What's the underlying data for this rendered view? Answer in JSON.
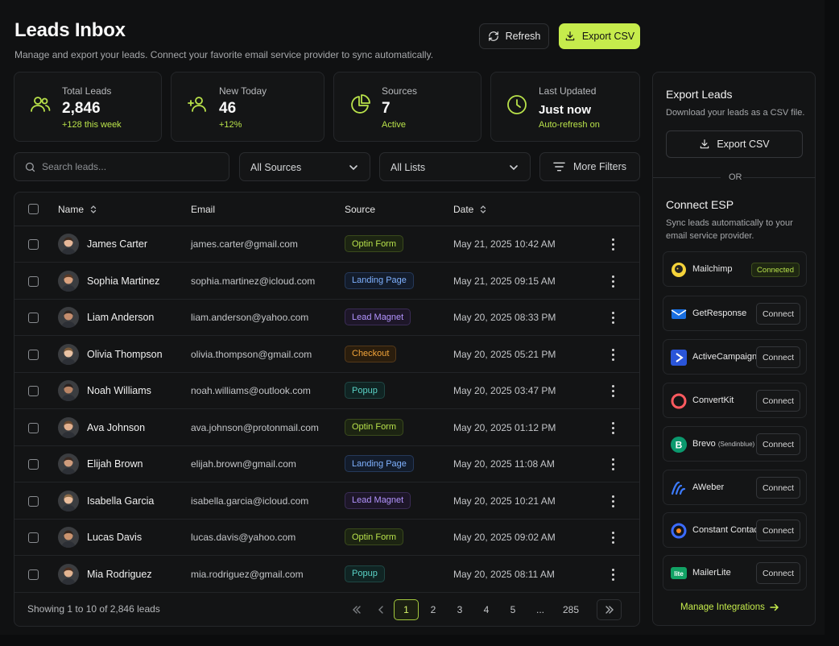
{
  "header": {
    "title": "Leads Inbox",
    "subtitle": "Manage and export your leads. Connect your favorite email service provider to sync automatically.",
    "refresh_label": "Refresh",
    "export_label": "Export CSV"
  },
  "stats": [
    {
      "label": "Total Leads",
      "value": "2,846",
      "sub": "+128 this week",
      "icon": "users-icon"
    },
    {
      "label": "New Today",
      "value": "46",
      "sub": "+12%",
      "icon": "user-plus-icon"
    },
    {
      "label": "Sources",
      "value": "7",
      "sub": "Active",
      "icon": "pie-chart-icon"
    },
    {
      "label": "Last Updated",
      "value": "Just now",
      "sub": "Auto-refresh on",
      "icon": "clock-icon"
    }
  ],
  "filters": {
    "search_placeholder": "Search leads...",
    "sources": "All Sources",
    "lists": "All Lists",
    "more": "More Filters"
  },
  "table": {
    "columns": {
      "name": "Name",
      "email": "Email",
      "source": "Source",
      "date": "Date"
    },
    "rows": [
      {
        "name": "James Carter",
        "email": "james.carter@gmail.com",
        "source": "Optin Form",
        "date": "May 21, 2025 10:42 AM"
      },
      {
        "name": "Sophia Martinez",
        "email": "sophia.martinez@icloud.com",
        "source": "Landing Page",
        "date": "May 21, 2025 09:15 AM"
      },
      {
        "name": "Liam Anderson",
        "email": "liam.anderson@yahoo.com",
        "source": "Lead Magnet",
        "date": "May 20, 2025 08:33 PM"
      },
      {
        "name": "Olivia Thompson",
        "email": "olivia.thompson@gmail.com",
        "source": "Checkout",
        "date": "May 20, 2025 05:21 PM"
      },
      {
        "name": "Noah Williams",
        "email": "noah.williams@outlook.com",
        "source": "Popup",
        "date": "May 20, 2025 03:47 PM"
      },
      {
        "name": "Ava Johnson",
        "email": "ava.johnson@protonmail.com",
        "source": "Optin Form",
        "date": "May 20, 2025 01:12 PM"
      },
      {
        "name": "Elijah Brown",
        "email": "elijah.brown@gmail.com",
        "source": "Landing Page",
        "date": "May 20, 2025 11:08 AM"
      },
      {
        "name": "Isabella Garcia",
        "email": "isabella.garcia@icloud.com",
        "source": "Lead Magnet",
        "date": "May 20, 2025 10:21 AM"
      },
      {
        "name": "Lucas Davis",
        "email": "lucas.davis@yahoo.com",
        "source": "Optin Form",
        "date": "May 20, 2025 09:02 AM"
      },
      {
        "name": "Mia Rodriguez",
        "email": "mia.rodriguez@gmail.com",
        "source": "Popup",
        "date": "May 20, 2025 08:11 AM"
      }
    ],
    "footer": "Showing 1 to 10 of 2,846 leads",
    "pages": [
      "1",
      "2",
      "3",
      "4",
      "5",
      "...",
      "285"
    ]
  },
  "source_colors": {
    "Optin Form": {
      "fg": "#b7e14b",
      "bg": "#1c2412",
      "bd": "#3a4a1c"
    },
    "Landing Page": {
      "fg": "#7fb1ff",
      "bg": "#131c2b",
      "bd": "#25395a"
    },
    "Lead Magnet": {
      "fg": "#b394ff",
      "bg": "#1d1628",
      "bd": "#3a2c55"
    },
    "Checkout": {
      "fg": "#f2a43a",
      "bg": "#2a1d0d",
      "bd": "#54391a"
    },
    "Popup": {
      "fg": "#5ad3c7",
      "bg": "#102423",
      "bd": "#1f4744"
    }
  },
  "sidebar": {
    "export_title": "Export Leads",
    "export_desc": "Download your leads as a CSV file.",
    "export_button": "Export CSV",
    "or": "OR",
    "connect_title": "Connect ESP",
    "connect_desc": "Sync leads automatically to your email service provider.",
    "esps": [
      {
        "name": "Mailchimp",
        "status": "Connected"
      },
      {
        "name": "GetResponse",
        "status": "Connect"
      },
      {
        "name": "ActiveCampaign",
        "status": "Connect"
      },
      {
        "name": "ConvertKit",
        "status": "Connect"
      },
      {
        "name": "Brevo",
        "note": "(Sendinblue)",
        "status": "Connect"
      },
      {
        "name": "AWeber",
        "status": "Connect"
      },
      {
        "name": "Constant Contact",
        "status": "Connect"
      },
      {
        "name": "MailerLite",
        "status": "Connect"
      }
    ],
    "manage": "Manage Integrations"
  },
  "colors": {
    "accent": "#c6ec4c",
    "background": "#101112",
    "card": "#141516"
  }
}
